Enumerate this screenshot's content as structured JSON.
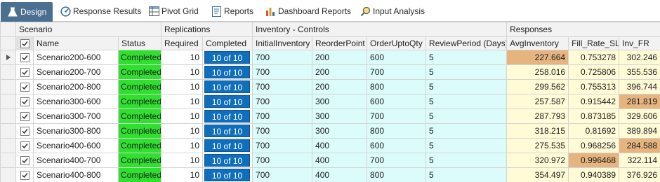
{
  "tabs": [
    {
      "label": "Design",
      "icon": "flask-icon"
    },
    {
      "label": "Response Results",
      "icon": "gauge-icon"
    },
    {
      "label": "Pivot Grid",
      "icon": "pivot-grid-icon"
    },
    {
      "label": "Reports",
      "icon": "report-icon"
    },
    {
      "label": "Dashboard Reports",
      "icon": "bar-chart-icon"
    },
    {
      "label": "Input Analysis",
      "icon": "magnifier-icon"
    }
  ],
  "groups": {
    "scenario": "Scenario",
    "replications": "Replications",
    "controls": "Inventory -  Controls",
    "responses": "Responses"
  },
  "columns": {
    "name": "Name",
    "status": "Status",
    "required": "Required",
    "completed": "Completed",
    "initial_inventory": "InitialInventory",
    "reorder_point": "ReorderPoint",
    "order_upto_qty": "OrderUptoQty",
    "review_period": "ReviewPeriod (Days)",
    "avg_inventory": "AvgInventory",
    "fill_rate": "Fill_Rate_SL",
    "inv_fr": "Inv_FR"
  },
  "colors": {
    "status_completed": "#2fe02f",
    "progress": "#0f6fbd",
    "controls_bg": "#dcfbfb",
    "responses_bg": "#fffbd7",
    "best_highlight": "#e5b47f",
    "active_tab": "#4a6f91"
  },
  "rows": [
    {
      "checked": true,
      "name": "Scenario200-600",
      "status": "Completed",
      "required": "10",
      "completed": "10 of 10",
      "initial": "700",
      "reorder": "200",
      "upto": "600",
      "review": "5",
      "avg": "227.664",
      "fill": "0.753278",
      "invfr": "302.246",
      "hl": "avg"
    },
    {
      "checked": true,
      "name": "Scenario200-700",
      "status": "Completed",
      "required": "10",
      "completed": "10 of 10",
      "initial": "700",
      "reorder": "200",
      "upto": "700",
      "review": "5",
      "avg": "258.016",
      "fill": "0.725806",
      "invfr": "355.536",
      "hl": ""
    },
    {
      "checked": true,
      "name": "Scenario200-800",
      "status": "Completed",
      "required": "10",
      "completed": "10 of 10",
      "initial": "700",
      "reorder": "200",
      "upto": "800",
      "review": "5",
      "avg": "299.562",
      "fill": "0.755313",
      "invfr": "396.744",
      "hl": ""
    },
    {
      "checked": true,
      "name": "Scenario300-600",
      "status": "Completed",
      "required": "10",
      "completed": "10 of 10",
      "initial": "700",
      "reorder": "300",
      "upto": "600",
      "review": "5",
      "avg": "257.587",
      "fill": "0.915442",
      "invfr": "281.819",
      "hl": "invfr"
    },
    {
      "checked": true,
      "name": "Scenario300-700",
      "status": "Completed",
      "required": "10",
      "completed": "10 of 10",
      "initial": "700",
      "reorder": "300",
      "upto": "700",
      "review": "5",
      "avg": "287.793",
      "fill": "0.873185",
      "invfr": "329.606",
      "hl": ""
    },
    {
      "checked": true,
      "name": "Scenario300-800",
      "status": "Completed",
      "required": "10",
      "completed": "10 of 10",
      "initial": "700",
      "reorder": "300",
      "upto": "800",
      "review": "5",
      "avg": "318.215",
      "fill": "0.81692",
      "invfr": "389.894",
      "hl": ""
    },
    {
      "checked": true,
      "name": "Scenario400-600",
      "status": "Completed",
      "required": "10",
      "completed": "10 of 10",
      "initial": "700",
      "reorder": "400",
      "upto": "600",
      "review": "5",
      "avg": "275.535",
      "fill": "0.968256",
      "invfr": "284.588",
      "hl": "invfr"
    },
    {
      "checked": true,
      "name": "Scenario400-700",
      "status": "Completed",
      "required": "10",
      "completed": "10 of 10",
      "initial": "700",
      "reorder": "400",
      "upto": "700",
      "review": "5",
      "avg": "320.972",
      "fill": "0.996468",
      "invfr": "322.114",
      "hl": "fill"
    },
    {
      "checked": true,
      "name": "Scenario400-800",
      "status": "Completed",
      "required": "10",
      "completed": "10 of 10",
      "initial": "700",
      "reorder": "400",
      "upto": "800",
      "review": "5",
      "avg": "354.497",
      "fill": "0.940389",
      "invfr": "376.926",
      "hl": ""
    }
  ]
}
